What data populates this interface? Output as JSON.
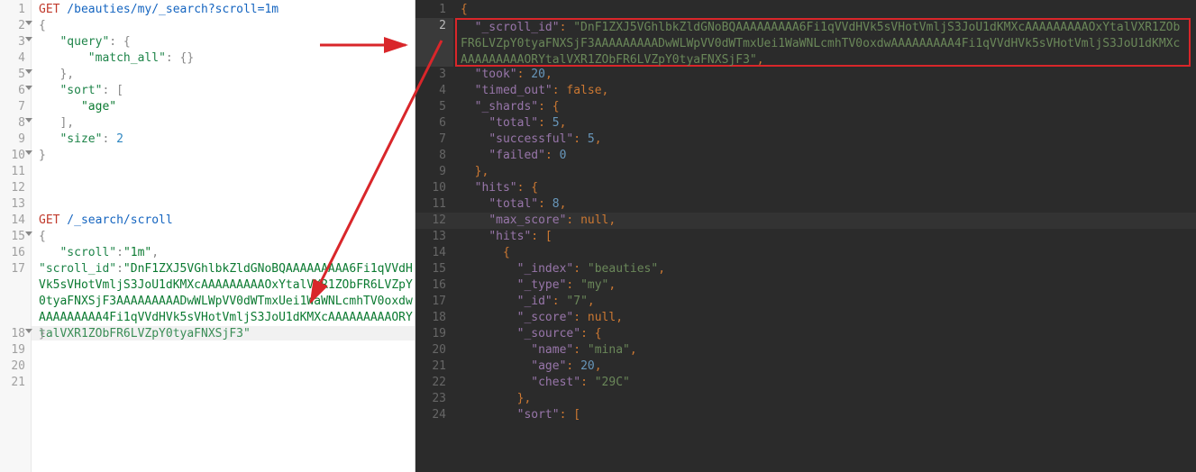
{
  "left": {
    "line1_method": "GET",
    "line1_path": " /beauties/my/_search?scroll=1m",
    "line2": "{",
    "line3_k": "\"query\"",
    "line3_rest": ": {",
    "line4_k": "\"match_all\"",
    "line4_rest": ": {}",
    "line5": "},",
    "line6_k": "\"sort\"",
    "line6_rest": ": [",
    "line7": "\"age\"",
    "line8": "],",
    "line9_k": "\"size\"",
    "line9_rest": ": ",
    "line9_num": "2",
    "line10": "}",
    "line14_method": "GET",
    "line14_path": " /_search/scroll",
    "line15": "{",
    "line16_k": "\"scroll\"",
    "line16_v": "\"1m\"",
    "line17_k": "\"scroll_id\"",
    "line17_v": "\"DnF1ZXJ5VGhlbkZldGNoBQAAAAAAAAA6Fi1qVVdHVk5sVHotVmljS3JoU1dKMXcAAAAAAAAAOxYtalVXR1ZObFR6LVZpY0tyaFNXSjF3AAAAAAAAADwWLWpVV0dWTmxUei1WaWNLcmhTV0oxdwAAAAAAAAA4Fi1qVVdHVk5sVHotVmljS3JoU1dKMXcAAAAAAAAAORYtalVXR1ZObFR6LVZpY0tyaFNXSjF3\"",
    "line18": "}"
  },
  "right": {
    "l1": "{",
    "l2_key": "\"_scroll_id\"",
    "l2_val": "\"DnF1ZXJ5VGhlbkZldGNoBQAAAAAAAAA6Fi1qVVdHVk5sVHotVmljS3JoU1dKMXcAAAAAAAAAOxYtalVXR1ZObFR6LVZpY0tyaFNXSjF3AAAAAAAAADwWLWpVV0dWTmxUei1WaWNLcmhTV0oxdwAAAAAAAAA4Fi1qVVdHVk5sVHotVmljS3JoU1dKMXcAAAAAAAAAORYtalVXR1ZObFR6LVZpY0tyaFNXSjF3\"",
    "l3_key": "\"took\"",
    "l3_val": "20",
    "l4_key": "\"timed_out\"",
    "l4_val": "false",
    "l5_key": "\"_shards\"",
    "l6_key": "\"total\"",
    "l6_val": "5",
    "l7_key": "\"successful\"",
    "l7_val": "5",
    "l8_key": "\"failed\"",
    "l8_val": "0",
    "l10_key": "\"hits\"",
    "l11_key": "\"total\"",
    "l11_val": "8",
    "l12_key": "\"max_score\"",
    "l12_val": "null",
    "l13_key": "\"hits\"",
    "l15_key": "\"_index\"",
    "l15_val": "\"beauties\"",
    "l16_key": "\"_type\"",
    "l16_val": "\"my\"",
    "l17_key": "\"_id\"",
    "l17_val": "\"7\"",
    "l18_key": "\"_score\"",
    "l18_val": "null",
    "l19_key": "\"_source\"",
    "l20_key": "\"name\"",
    "l20_val": "\"mina\"",
    "l21_key": "\"age\"",
    "l21_val": "20",
    "l22_key": "\"chest\"",
    "l22_val": "\"29C\"",
    "l24_key": "\"sort\""
  }
}
